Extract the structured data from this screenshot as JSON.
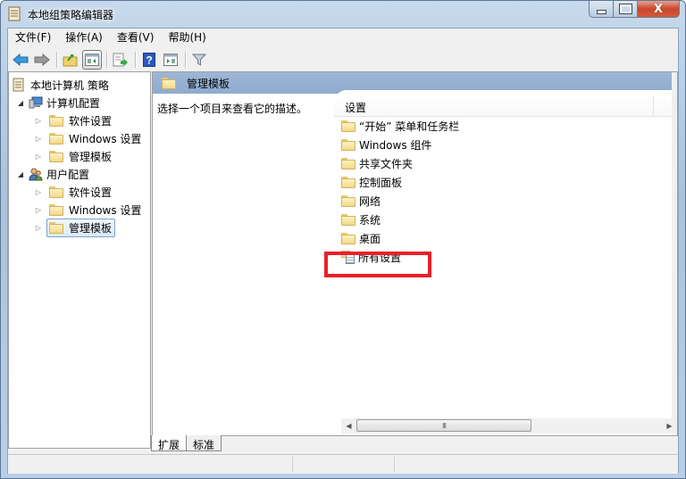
{
  "window": {
    "title": "本地组策略编辑器",
    "controls": {
      "minimize": "—",
      "maximize": "□",
      "close": "X"
    }
  },
  "menubar": {
    "items": [
      {
        "label": "文件(F)"
      },
      {
        "label": "操作(A)"
      },
      {
        "label": "查看(V)"
      },
      {
        "label": "帮助(H)"
      }
    ]
  },
  "toolbar": {
    "buttons": [
      "back-icon",
      "forward-icon",
      "up-folder-icon",
      "show-hide-tree-icon",
      "export-list-icon",
      "help-icon",
      "show-hide-action-pane-icon",
      "filter-icon"
    ]
  },
  "tree": {
    "root": {
      "label": "本地计算机 策略",
      "icon": "policy-document-icon"
    },
    "nodes": [
      {
        "label": "计算机配置",
        "icon": "computer-icon",
        "expanded": true,
        "level": 1
      },
      {
        "label": "软件设置",
        "icon": "folder-icon",
        "level": 2
      },
      {
        "label": "Windows 设置",
        "icon": "folder-icon",
        "level": 2
      },
      {
        "label": "管理模板",
        "icon": "folder-icon",
        "level": 2
      },
      {
        "label": "用户配置",
        "icon": "users-icon",
        "expanded": true,
        "level": 1
      },
      {
        "label": "软件设置",
        "icon": "folder-icon",
        "level": 2
      },
      {
        "label": "Windows 设置",
        "icon": "folder-icon",
        "level": 2
      },
      {
        "label": "管理模板",
        "icon": "folder-icon",
        "level": 2,
        "selected": true
      }
    ]
  },
  "details": {
    "header_title": "管理模板",
    "description": "选择一个项目来查看它的描述。",
    "column_header": "设置",
    "items": [
      {
        "label": "“开始” 菜单和任务栏",
        "icon": "folder-icon"
      },
      {
        "label": "Windows 组件",
        "icon": "folder-icon"
      },
      {
        "label": "共享文件夹",
        "icon": "folder-icon"
      },
      {
        "label": "控制面板",
        "icon": "folder-icon"
      },
      {
        "label": "网络",
        "icon": "folder-icon"
      },
      {
        "label": "系统",
        "icon": "folder-icon"
      },
      {
        "label": "桌面",
        "icon": "folder-icon"
      },
      {
        "label": "所有设置",
        "icon": "all-settings-icon",
        "highlighted": true
      }
    ],
    "highlight_color": "#e8202a"
  },
  "scrollbar": {
    "thumb_grip": "III",
    "left_arrow": "◀",
    "right_arrow": "▶"
  },
  "tabs": [
    {
      "label": "扩展",
      "active": true
    },
    {
      "label": "标准",
      "active": false
    }
  ],
  "colors": {
    "header_bar": "#9db6d6",
    "close_button": "#c8452c",
    "chrome": "#f0f0f0"
  }
}
